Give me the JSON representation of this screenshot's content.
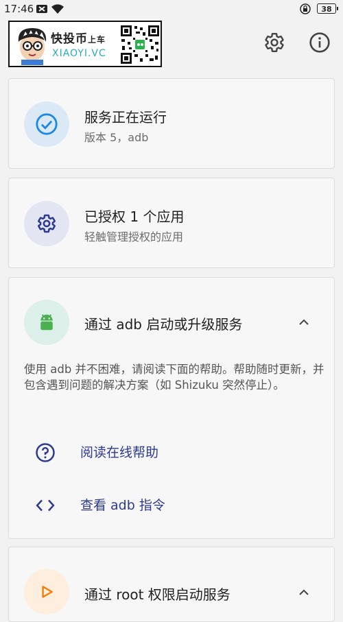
{
  "status_bar": {
    "time": "17:46",
    "battery": "38"
  },
  "banner": {
    "brand": "快投币",
    "brand_tail": "上车",
    "site": "XIAOYI.VC"
  },
  "toolbar": {
    "settings_icon": "gear-icon",
    "about_icon": "info-icon"
  },
  "cards": {
    "service": {
      "title": "服务正在运行",
      "subtitle": "版本 5，adb",
      "icon": "check-circle-icon"
    },
    "authorized": {
      "title": "已授权 1 个应用",
      "subtitle": "轻触管理授权的应用",
      "icon": "gear-icon"
    },
    "adb": {
      "title": "通过 adb 启动或升级服务",
      "icon": "android-icon",
      "description": "使用 adb 并不困难，请阅读下面的帮助。帮助随时更新，并包含遇到问题的解决方案（如 Shizuku 突然停止）。",
      "actions": [
        {
          "label": "阅读在线帮助",
          "icon": "help-circle-icon"
        },
        {
          "label": "查看 adb 指令",
          "icon": "code-icon"
        }
      ]
    },
    "root": {
      "title": "通过 root 权限启动服务",
      "icon": "play-icon"
    }
  },
  "colors": {
    "accent": "#2b3a93",
    "check": "#1e88e5",
    "root_orange": "#f57c00",
    "android_green": "#4caf50"
  }
}
